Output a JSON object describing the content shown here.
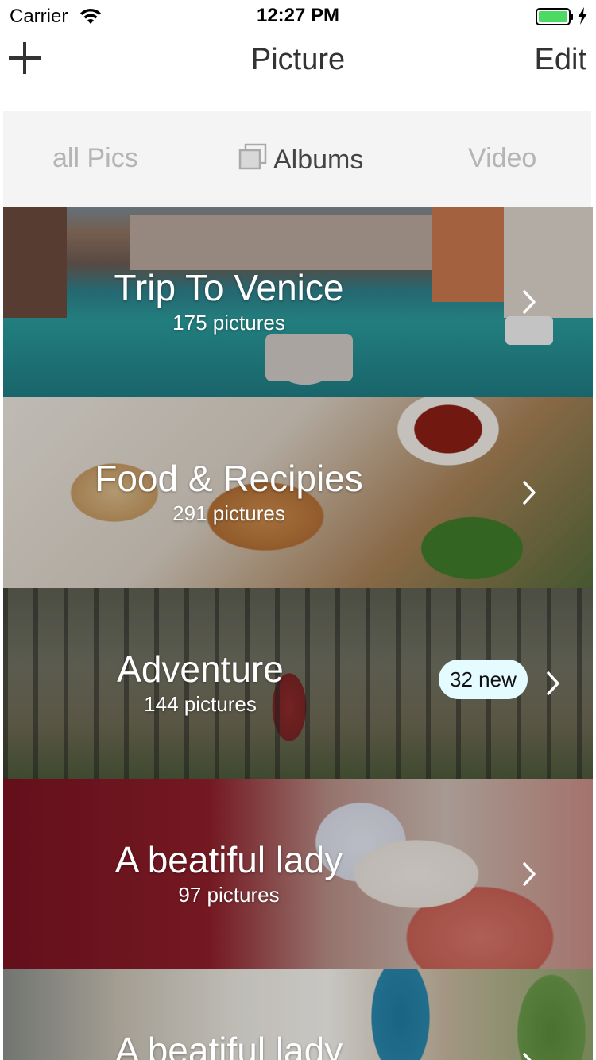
{
  "status_bar": {
    "carrier": "Carrier",
    "time": "12:27 PM",
    "battery_color": "#4cd964"
  },
  "nav": {
    "title": "Picture",
    "edit_label": "Edit",
    "add_icon": "plus-icon"
  },
  "tabs": [
    {
      "label": "all Pics",
      "active": false
    },
    {
      "label": "Albums",
      "active": true,
      "icon": "albums-icon"
    },
    {
      "label": "Video",
      "active": false
    }
  ],
  "albums": [
    {
      "title": "Trip To Venice",
      "count": "175 pictures"
    },
    {
      "title": "Food & Recipies",
      "count": "291 pictures"
    },
    {
      "title": "Adventure",
      "count": "144 pictures",
      "badge": "32 new"
    },
    {
      "title": "A beatiful lady",
      "count": "97 pictures"
    },
    {
      "title": "A beatiful lady",
      "count": ""
    }
  ],
  "colors": {
    "badge_bg": "#e4fbff",
    "tab_bar_bg": "#f4f4f4",
    "tab_inactive": "#b5b5b5"
  }
}
